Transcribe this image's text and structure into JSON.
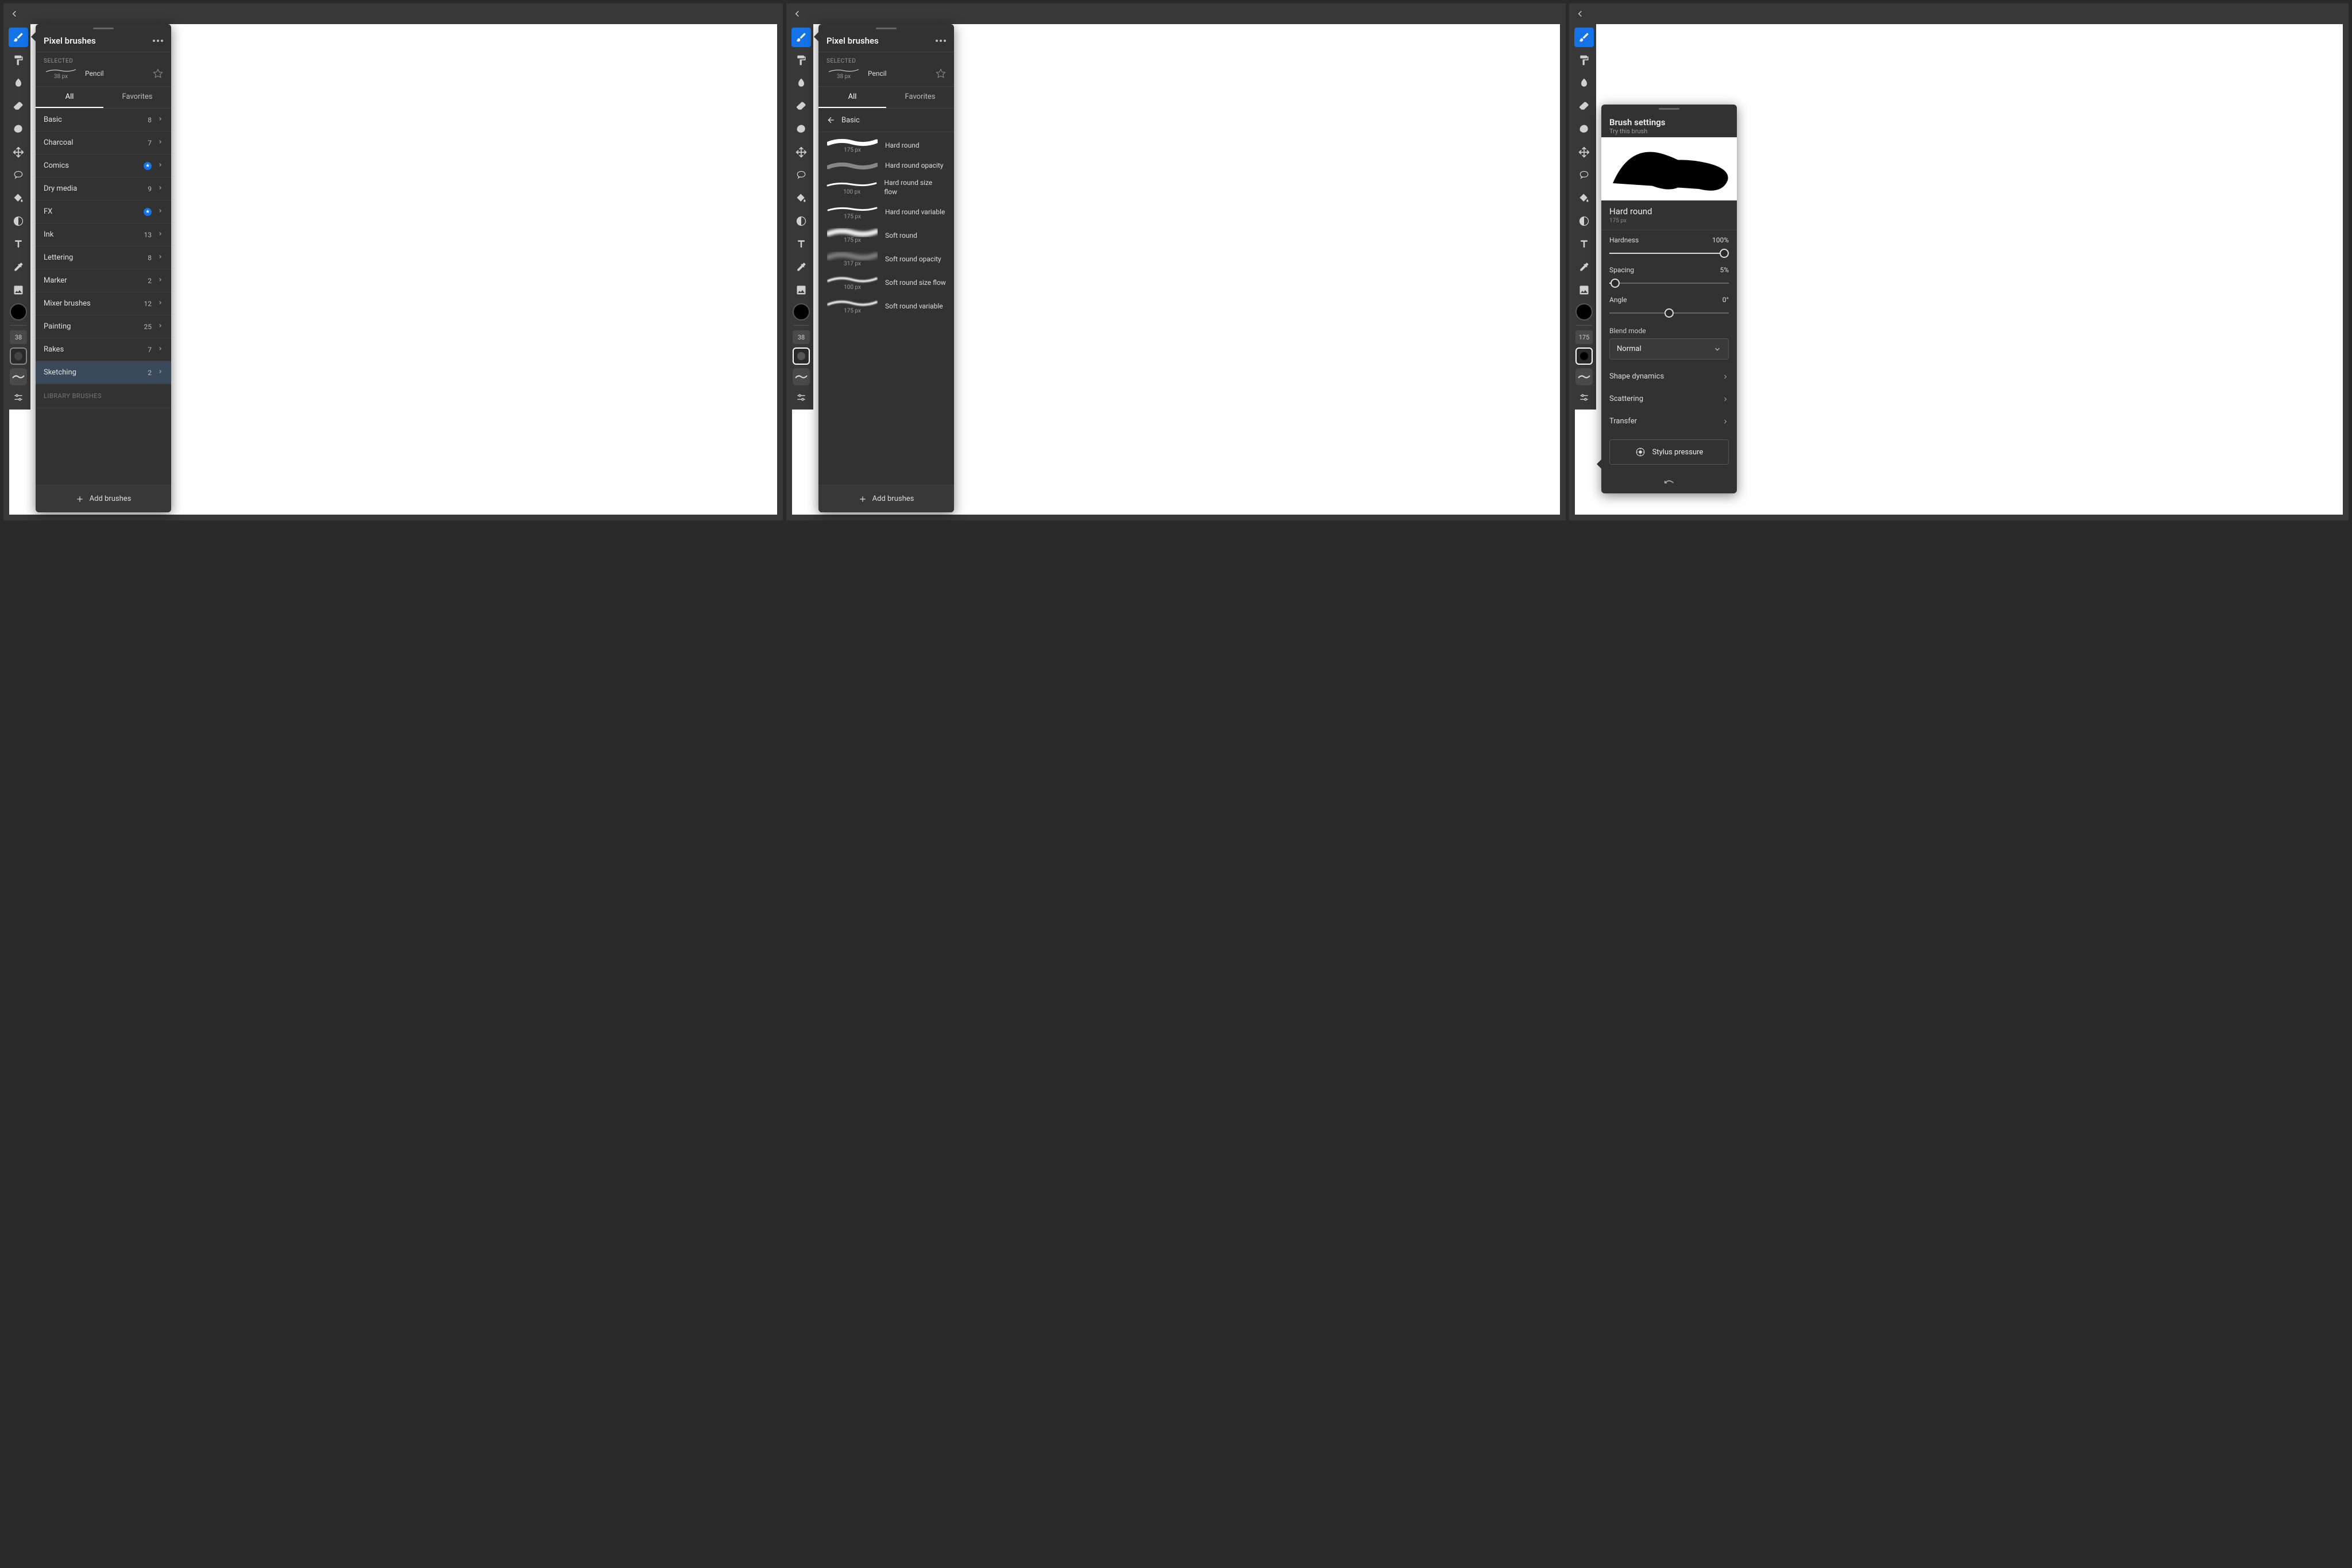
{
  "toolbar": {
    "size_label_a": "38",
    "size_label_b": "38",
    "size_label_c": "175"
  },
  "panel1": {
    "title": "Pixel brushes",
    "selected_label": "SELECTED",
    "selected_name": "Pencil",
    "selected_size": "38 px",
    "tab_all": "All",
    "tab_fav": "Favorites",
    "categories": [
      {
        "name": "Basic",
        "count": "8",
        "badge": false
      },
      {
        "name": "Charcoal",
        "count": "7",
        "badge": false
      },
      {
        "name": "Comics",
        "count": "",
        "badge": true
      },
      {
        "name": "Dry media",
        "count": "9",
        "badge": false
      },
      {
        "name": "FX",
        "count": "",
        "badge": true
      },
      {
        "name": "Ink",
        "count": "13",
        "badge": false
      },
      {
        "name": "Lettering",
        "count": "8",
        "badge": false
      },
      {
        "name": "Marker",
        "count": "2",
        "badge": false
      },
      {
        "name": "Mixer brushes",
        "count": "12",
        "badge": false
      },
      {
        "name": "Painting",
        "count": "25",
        "badge": false
      },
      {
        "name": "Rakes",
        "count": "7",
        "badge": false
      },
      {
        "name": "Sketching",
        "count": "2",
        "badge": false,
        "highlight": true
      }
    ],
    "library_label": "LIBRARY BRUSHES",
    "add_label": "Add brushes"
  },
  "panel2": {
    "title": "Pixel brushes",
    "selected_label": "SELECTED",
    "selected_name": "Pencil",
    "selected_size": "38 px",
    "tab_all": "All",
    "tab_fav": "Favorites",
    "back_label": "Basic",
    "brushes": [
      {
        "name": "Hard round",
        "size": "175 px",
        "stroke": "hard"
      },
      {
        "name": "Hard round opacity",
        "size": "",
        "stroke": "hard-fade"
      },
      {
        "name": "Hard round size flow",
        "size": "100 px",
        "stroke": "taper"
      },
      {
        "name": "Hard round variable",
        "size": "175 px",
        "stroke": "taper"
      },
      {
        "name": "Soft round",
        "size": "175 px",
        "stroke": "soft"
      },
      {
        "name": "Soft round opacity",
        "size": "317 px",
        "stroke": "soft-fade"
      },
      {
        "name": "Soft round size flow",
        "size": "100 px",
        "stroke": "soft-taper"
      },
      {
        "name": "Soft round variable",
        "size": "175 px",
        "stroke": "soft-taper"
      }
    ],
    "add_label": "Add brushes"
  },
  "panel3": {
    "title": "Brush settings",
    "try_label": "Try this brush",
    "brush_name": "Hard round",
    "brush_size": "175 px",
    "sliders": {
      "hardness": {
        "label": "Hardness",
        "value": "100%",
        "pos": 100
      },
      "spacing": {
        "label": "Spacing",
        "value": "5%",
        "pos": 5
      },
      "angle": {
        "label": "Angle",
        "value": "0°",
        "pos": 50
      }
    },
    "blend_label": "Blend mode",
    "blend_value": "Normal",
    "rows": {
      "shape": "Shape dynamics",
      "scatter": "Scattering",
      "transfer": "Transfer"
    },
    "stylus_label": "Stylus pressure"
  }
}
